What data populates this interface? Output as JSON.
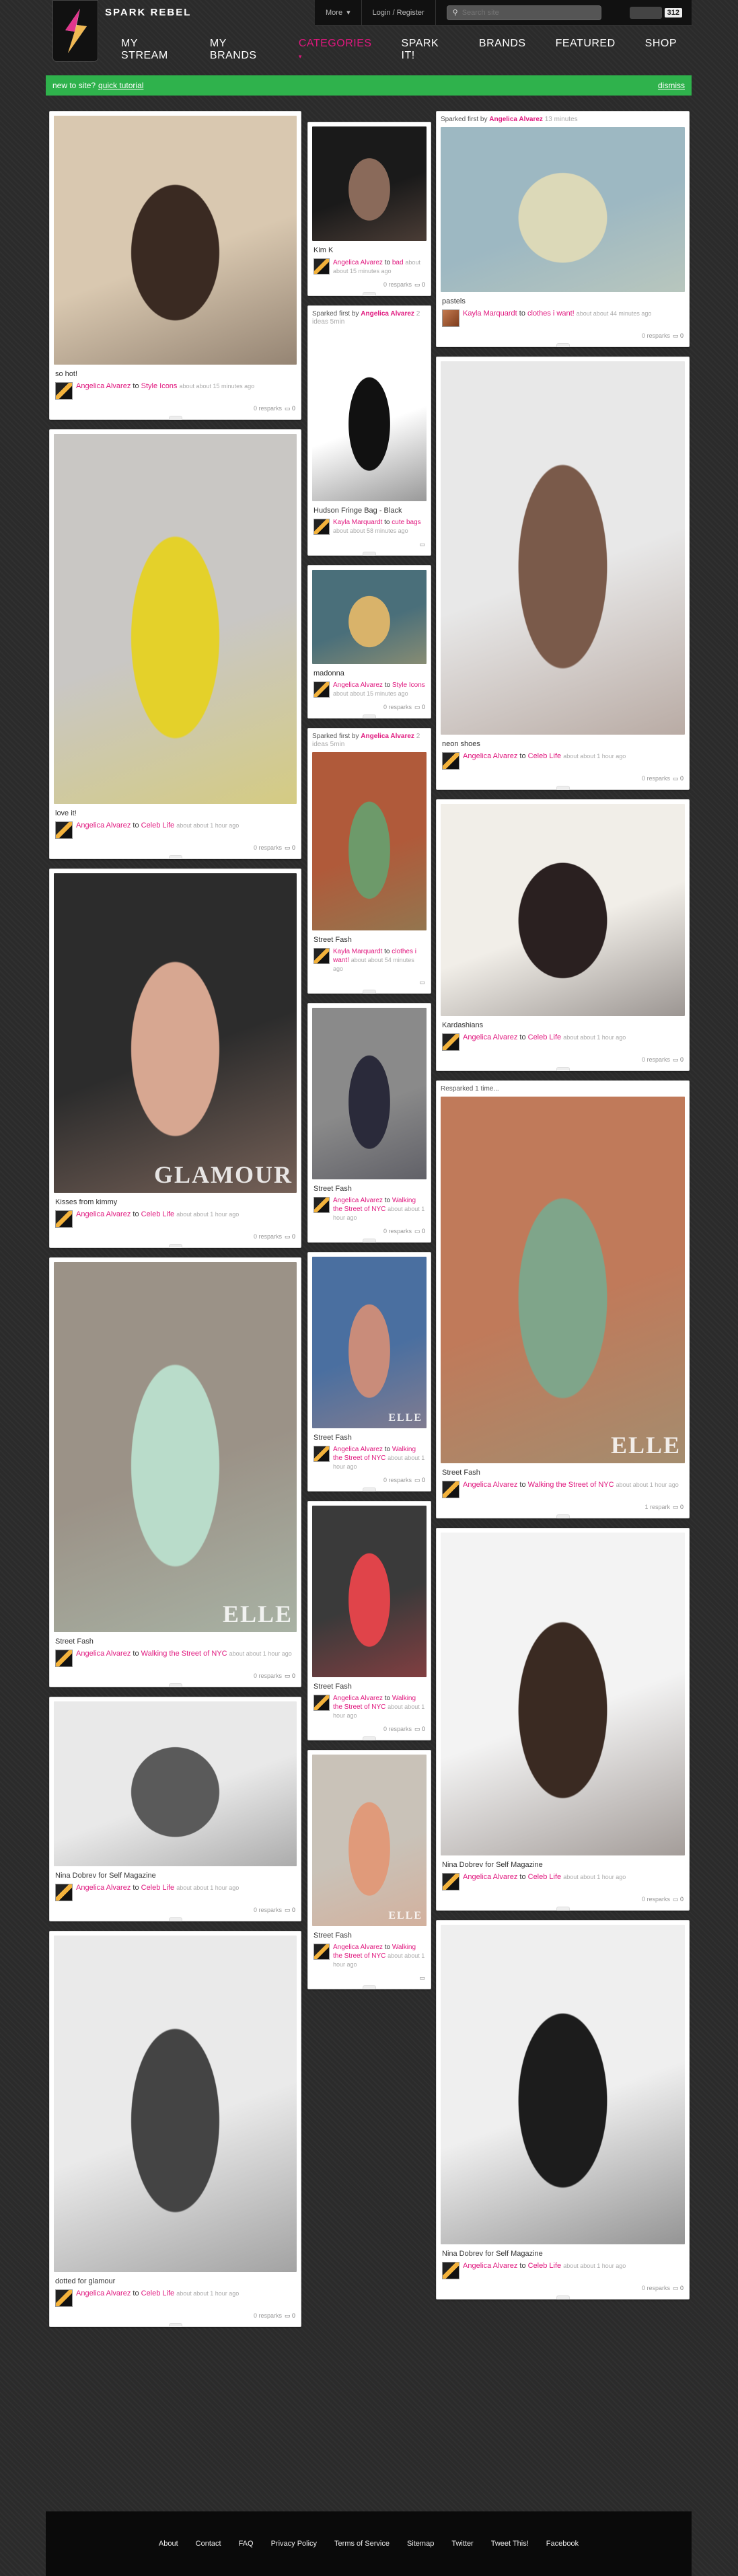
{
  "brand": {
    "name": "SPARK REBEL"
  },
  "topbar": {
    "more_label": "More",
    "login_label": "Login / Register",
    "search_placeholder": "Search site",
    "count": "312"
  },
  "nav": [
    {
      "label": "My Stream",
      "active": false
    },
    {
      "label": "My Brands",
      "active": false
    },
    {
      "label": "Categories",
      "active": true
    },
    {
      "label": "Spark It!",
      "active": false
    },
    {
      "label": "Brands",
      "active": false
    },
    {
      "label": "Featured",
      "active": false
    },
    {
      "label": "Shop",
      "active": false
    }
  ],
  "tutorial": {
    "text": "new to site?",
    "link": "quick tutorial",
    "dismiss": "dismiss"
  },
  "colors": {
    "accent": "#e0177e",
    "tutorial_bg": "#2fb24c"
  },
  "col1": [
    {
      "title": "so hot!",
      "user": "Angelica Alvarez",
      "board": "Style Icons",
      "time": "about about 15 minutes ago",
      "stats": "0 resparks",
      "comments": "0",
      "photo_h": 370,
      "photo_tone": [
        "#d9c8b0",
        "#3a2a22"
      ]
    },
    {
      "title": "love it!",
      "user": "Angelica Alvarez",
      "board": "Celeb Life",
      "time": "about about 1 hour ago",
      "stats": "0 resparks",
      "comments": "0",
      "photo_h": 550,
      "photo_tone": [
        "#c9c7c4",
        "#e4d12a"
      ]
    },
    {
      "title": "Kisses from kimmy",
      "user": "Angelica Alvarez",
      "board": "Celeb Life",
      "time": "about about 1 hour ago",
      "stats": "0 resparks",
      "comments": "0",
      "photo_h": 475,
      "photo_tone": [
        "#2c2c2c",
        "#d7a791"
      ],
      "overlay": "GLAMOUR"
    },
    {
      "title": "Street Fash",
      "user": "Angelica Alvarez",
      "board": "Walking the Street of NYC",
      "time": "about about 1 hour ago",
      "stats": "0 resparks",
      "comments": "0",
      "photo_h": 550,
      "photo_tone": [
        "#9b9287",
        "#b9dcca"
      ],
      "overlay": "ELLE"
    },
    {
      "title": "Nina Dobrev for Self Magazine",
      "user": "Angelica Alvarez",
      "board": "Celeb Life",
      "time": "about about 1 hour ago",
      "stats": "0 resparks",
      "comments": "0",
      "photo_h": 245,
      "photo_tone": [
        "#e9e9e9",
        "#5a5a5a"
      ]
    },
    {
      "title": "dotted for glamour",
      "user": "Angelica Alvarez",
      "board": "Celeb Life",
      "time": "about about 1 hour ago",
      "stats": "0 resparks",
      "comments": "0",
      "photo_h": 500,
      "photo_tone": [
        "#eaeaea",
        "#444444"
      ]
    }
  ],
  "col2": [
    {
      "title": "Kim K",
      "user": "Angelica Alvarez",
      "board": "bad",
      "time": "about about 15 minutes ago",
      "stats": "0 resparks",
      "comments": "0",
      "photo_h": 170,
      "photo_tone": [
        "#1a1a1a",
        "#8a6a5a"
      ]
    },
    {
      "sparked_by": "Angelica Alvarez",
      "sparked_when": "2 ideas 5min",
      "sparked_prefix": "Sparked first by",
      "title": "Hudson Fringe Bag - Black",
      "user": "Kayla Marquardt",
      "board": "cute bags",
      "time": "about about 58 minutes ago",
      "stats": "",
      "comments": "",
      "photo_h": 255,
      "photo_tone": [
        "#ffffff",
        "#111111"
      ]
    },
    {
      "title": "madonna",
      "user": "Angelica Alvarez",
      "board": "Style Icons",
      "time": "about about 15 minutes ago",
      "stats": "0 resparks",
      "comments": "0",
      "photo_h": 140,
      "photo_tone": [
        "#4a6f7a",
        "#d9b36a"
      ]
    },
    {
      "sparked_by": "Angelica Alvarez",
      "sparked_when": "2 ideas 5min",
      "sparked_prefix": "Sparked first by",
      "title": "Street Fash",
      "user": "Kayla Marquardt",
      "board": "clothes i want!",
      "time": "about about 54 minutes ago",
      "stats": "",
      "comments": "",
      "photo_h": 265,
      "photo_tone": [
        "#b05a3a",
        "#6d9a6a"
      ]
    },
    {
      "title": "Street Fash",
      "user": "Angelica Alvarez",
      "board": "Walking the Street of NYC",
      "time": "about about 1 hour ago",
      "stats": "0 resparks",
      "comments": "0",
      "photo_h": 255,
      "photo_tone": [
        "#8a8a8a",
        "#2a2a3a"
      ]
    },
    {
      "title": "Street Fash",
      "user": "Angelica Alvarez",
      "board": "Walking the Street of NYC",
      "time": "about about 1 hour ago",
      "stats": "0 resparks",
      "comments": "0",
      "photo_h": 255,
      "photo_tone": [
        "#4a6fa0",
        "#c98c7a"
      ],
      "overlay": "ELLE"
    },
    {
      "title": "Street Fash",
      "user": "Angelica Alvarez",
      "board": "Walking the Street of NYC",
      "time": "about about 1 hour ago",
      "stats": "0 resparks",
      "comments": "0",
      "photo_h": 255,
      "photo_tone": [
        "#3a3a3a",
        "#e0444a"
      ]
    },
    {
      "title": "Street Fash",
      "user": "Angelica Alvarez",
      "board": "Walking the Street of NYC",
      "time": "about about 1 hour ago",
      "stats": "",
      "comments": "",
      "photo_h": 255,
      "photo_tone": [
        "#c9c2b8",
        "#e09a7a"
      ],
      "overlay": "ELLE"
    }
  ],
  "col3": [
    {
      "sparked_by": "Angelica Alvarez",
      "sparked_when": "13 minutes",
      "sparked_prefix": "Sparked first by",
      "title": "pastels",
      "user": "Kayla Marquardt",
      "board": "clothes i want!",
      "time": "about about 44 minutes ago",
      "stats": "0 resparks",
      "comments": "0",
      "photo_h": 245,
      "photo_tone": [
        "#9db8c2",
        "#dcd9b8"
      ],
      "avatar_alt": true
    },
    {
      "title": "neon shoes",
      "user": "Angelica Alvarez",
      "board": "Celeb Life",
      "time": "about about 1 hour ago",
      "stats": "0 resparks",
      "comments": "0",
      "photo_h": 555,
      "photo_tone": [
        "#e8e8e8",
        "#7a5a4a"
      ]
    },
    {
      "title": "Kardashians",
      "user": "Angelica Alvarez",
      "board": "Celeb Life",
      "time": "about about 1 hour ago",
      "stats": "0 resparks",
      "comments": "0",
      "photo_h": 315,
      "photo_tone": [
        "#f1eee8",
        "#2a2020"
      ]
    },
    {
      "sparked_prefix": "Resparked 1 time...",
      "title": "Street Fash",
      "user": "Angelica Alvarez",
      "board": "Walking the Street of NYC",
      "time": "about about 1 hour ago",
      "stats": "1 respark",
      "comments": "0",
      "photo_h": 545,
      "photo_tone": [
        "#c07a5a",
        "#7fa58a"
      ],
      "overlay": "ELLE"
    },
    {
      "title": "Nina Dobrev for Self Magazine",
      "user": "Angelica Alvarez",
      "board": "Celeb Life",
      "time": "about about 1 hour ago",
      "stats": "0 resparks",
      "comments": "0",
      "photo_h": 480,
      "photo_tone": [
        "#f3f3f3",
        "#3a2a22"
      ]
    },
    {
      "title": "Nina Dobrev for Self Magazine",
      "user": "Angelica Alvarez",
      "board": "Celeb Life",
      "time": "about about 1 hour ago",
      "stats": "0 resparks",
      "comments": "0",
      "photo_h": 475,
      "photo_tone": [
        "#efefef",
        "#1c1c1c"
      ]
    }
  ],
  "footer": [
    "About",
    "Contact",
    "FAQ",
    "Privacy Policy",
    "Terms of Service",
    "Sitemap",
    "Twitter",
    "Tweet This!",
    "Facebook"
  ]
}
